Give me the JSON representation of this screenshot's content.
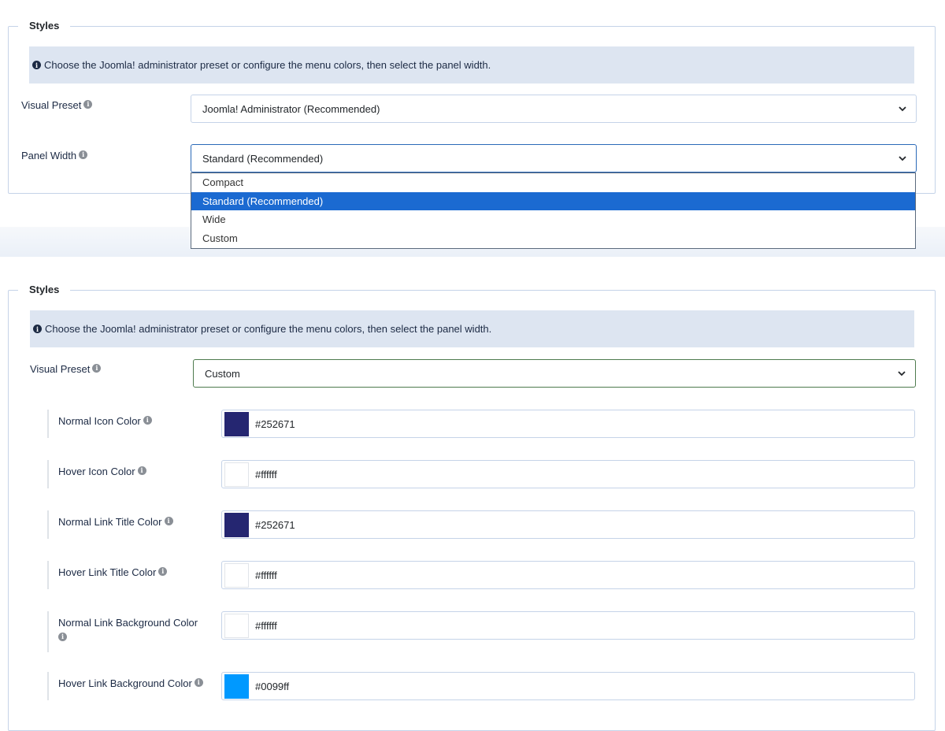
{
  "top_panel": {
    "legend": "Styles",
    "info_text": "Choose the Joomla! administrator preset or configure the menu colors, then select the panel width.",
    "visual_preset_label": "Visual Preset",
    "visual_preset_value": "Joomla! Administrator (Recommended)",
    "panel_width_label": "Panel Width",
    "panel_width_value": "Standard (Recommended)",
    "dropdown_options": [
      "Compact",
      "Standard (Recommended)",
      "Wide",
      "Custom"
    ],
    "dropdown_selected": "Standard (Recommended)"
  },
  "bottom_panel": {
    "legend": "Styles",
    "info_text": "Choose the Joomla! administrator preset or configure the menu colors, then select the panel width.",
    "visual_preset_label": "Visual Preset",
    "visual_preset_value": "Custom",
    "colors": [
      {
        "label": "Normal Icon Color",
        "value": "#252671",
        "swatch": "#252671"
      },
      {
        "label": "Hover Icon Color",
        "value": "#ffffff",
        "swatch": "#ffffff"
      },
      {
        "label": "Normal Link Title Color",
        "value": "#252671",
        "swatch": "#252671"
      },
      {
        "label": "Hover Link Title Color",
        "value": "#ffffff",
        "swatch": "#ffffff"
      },
      {
        "label": "Normal Link Background Color",
        "value": "#ffffff",
        "swatch": "#ffffff"
      },
      {
        "label": "Hover Link Background Color",
        "value": "#0099ff",
        "swatch": "#0099ff"
      }
    ]
  },
  "icons": {
    "info": "info-circle-icon",
    "help": "help-circle-icon",
    "chevron": "chevron-down-icon"
  },
  "theme": {
    "alert_bg": "#dde5f1",
    "selected_option": "#1b6ad1",
    "border": "#c5d3e8"
  }
}
